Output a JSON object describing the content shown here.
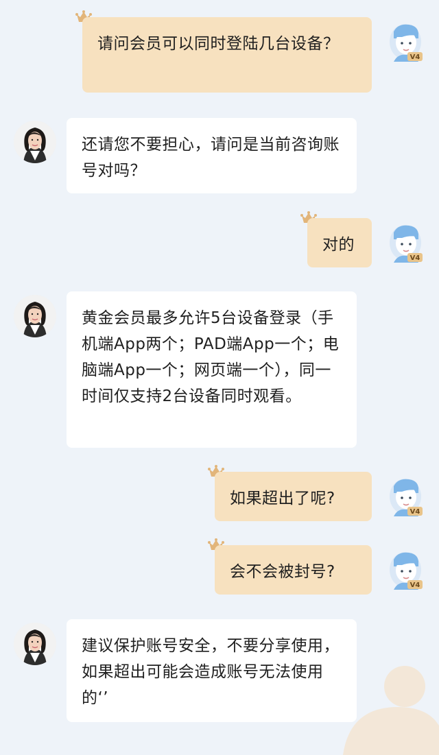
{
  "messages": [
    {
      "role": "user",
      "text": "请问会员可以同时登陆几台设备？",
      "badge": "V4"
    },
    {
      "role": "agent",
      "text": "还请您不要担心，请问是当前咨询账号对吗？"
    },
    {
      "role": "user",
      "text": "对的",
      "badge": "V4"
    },
    {
      "role": "agent",
      "text": "黄金会员最多允许5台设备登录（手机端App两个；PAD端App一个；电脑端App一个；网页端一个），同一时间仅支持2台设备同时观看。"
    },
    {
      "role": "user",
      "text": "如果超出了呢?",
      "badge": "V4"
    },
    {
      "role": "user",
      "text": "会不会被封号?",
      "badge": "V4"
    },
    {
      "role": "agent",
      "text": "建议保护账号安全，不要分享使用，如果超出可能会造成账号无法使用的‘’"
    }
  ],
  "icons": {
    "user_avatar": "user-avatar-icon",
    "agent_avatar": "agent-avatar-icon",
    "crown": "crown-icon"
  },
  "colors": {
    "background": "#eef3f9",
    "user_bubble": "#f7e1bf",
    "agent_bubble": "#ffffff",
    "badge": "#e9c48a"
  }
}
